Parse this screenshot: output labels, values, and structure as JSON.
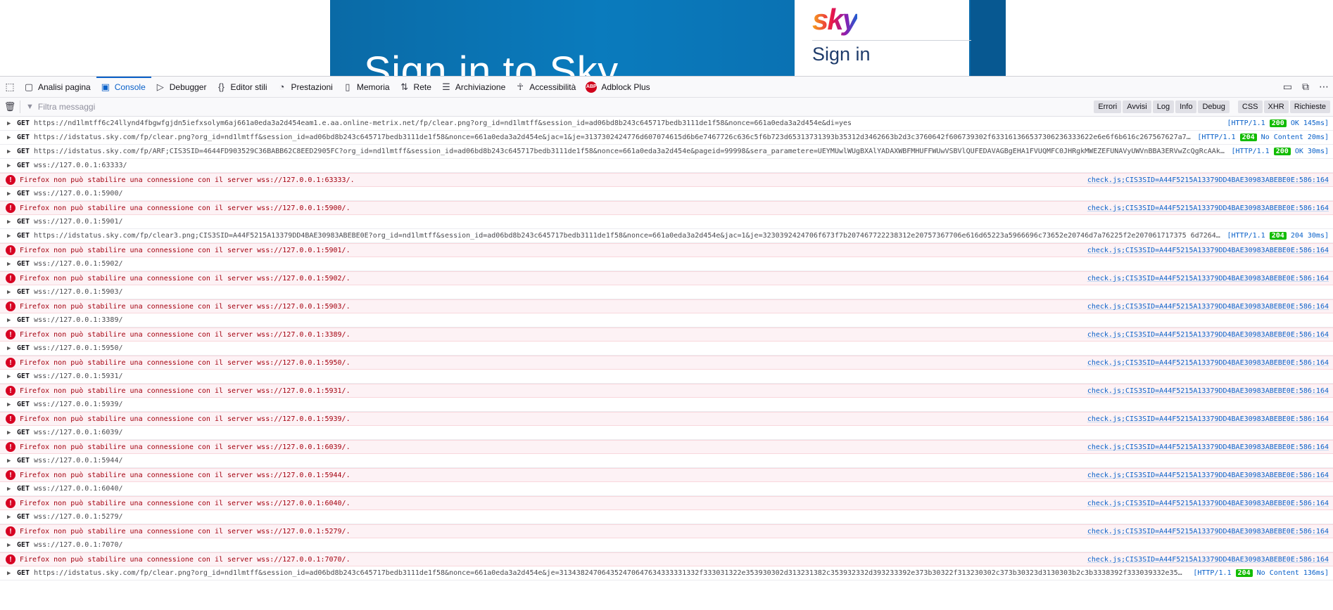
{
  "page": {
    "hero_title": "Sign in to Sky",
    "logo_text": "sky",
    "card_heading": "Sign in"
  },
  "toolbar": {
    "tabs": [
      {
        "label": "Analisi pagina",
        "icon": "inspector-icon"
      },
      {
        "label": "Console",
        "icon": "console-icon",
        "selected": true
      },
      {
        "label": "Debugger",
        "icon": "debugger-icon"
      },
      {
        "label": "Editor stili",
        "icon": "style-editor-icon"
      },
      {
        "label": "Prestazioni",
        "icon": "performance-icon"
      },
      {
        "label": "Memoria",
        "icon": "memory-icon"
      },
      {
        "label": "Rete",
        "icon": "network-icon"
      },
      {
        "label": "Archiviazione",
        "icon": "storage-icon"
      },
      {
        "label": "Accessibilità",
        "icon": "accessibility-icon"
      },
      {
        "label": "Adblock Plus",
        "icon": "adblock-icon"
      }
    ],
    "abp_badge": "ABP"
  },
  "filter": {
    "placeholder": "Filtra messaggi",
    "levels": [
      "Errori",
      "Avvisi",
      "Log",
      "Info",
      "Debug"
    ],
    "types": [
      "CSS",
      "XHR",
      "Richieste"
    ]
  },
  "colors": {
    "accent": "#0a61c9",
    "error_text": "#a4000f",
    "error_bg": "#fdf2f5",
    "status_ok": "#12bc00"
  },
  "messages": [
    {
      "kind": "net",
      "method": "GET",
      "url": "https://nd1lmtff6c24llynd4fbgwfgjdn5iefxsolym6aj661a0eda3a2d454eam1.e.aa.online-metrix.net/fp/clear.png?org_id=nd1lmtff&session_id=ad06bd8b243c645717bedb3111de1f58&nonce=661a0eda3a2d454e&di=yes",
      "proto": "[HTTP/1.1",
      "code": "200",
      "status_text": "OK 145ms]"
    },
    {
      "kind": "net",
      "method": "GET",
      "url": "https://idstatus.sky.com/fp/clear.png?org_id=nd1lmtff&session_id=ad06bd8b243c645717bedb3111de1f58&nonce=661a0eda3a2d454e&jac=1&je=3137302424776d607074615d6b6e7467726c636c5f6b723d65313731393b35312d3462663b2d3c3760642f606739302f633161366537306236333622e6e6f6b616c267567627a7…",
      "proto": "[HTTP/1.1",
      "code": "204",
      "status_text": "No Content 20ms]"
    },
    {
      "kind": "net",
      "method": "GET",
      "url": "https://idstatus.sky.com/fp/ARF;CIS3SID=4644FD903529C36BABB62C8EED2905FC?org_id=nd1lmtff&session_id=ad06bd8b243c645717bedb3111de1f58&nonce=661a0eda3a2d454e&pageid=99998&sera_parametere=UEYMUwlWUgBXAlYADAXWBFMHUFFWUwVSBVlQUFEDAVAGBgEHA1FVUQMFC0JHRgkMWEZEFUNAVyUWVnBBA3ERVwZcQgRcAAkE…",
      "proto": "[HTTP/1.1",
      "code": "200",
      "status_text": "OK 30ms]"
    },
    {
      "kind": "net",
      "method": "GET",
      "url": "wss://127.0.0.1:63333/"
    },
    {
      "kind": "err",
      "text": "Firefox non può stabilire una connessione con il server wss://127.0.0.1:63333/.",
      "source": "check.js;CIS3SID=A44F5215A13379DD4BAE30983ABEBE0E:586:164"
    },
    {
      "kind": "net",
      "method": "GET",
      "url": "wss://127.0.0.1:5900/"
    },
    {
      "kind": "err",
      "text": "Firefox non può stabilire una connessione con il server wss://127.0.0.1:5900/.",
      "source": "check.js;CIS3SID=A44F5215A13379DD4BAE30983ABEBE0E:586:164"
    },
    {
      "kind": "net",
      "method": "GET",
      "url": "wss://127.0.0.1:5901/"
    },
    {
      "kind": "net",
      "method": "GET",
      "url": "https://idstatus.sky.com/fp/clear3.png;CIS3SID=A44F5215A13379DD4BAE30983ABEBE0E?org_id=nd1lmtff&session_id=ad06bd8b243c645717bedb3111de1f58&nonce=661a0eda3a2d454e&jac=1&je=3230392424706f673f7b207467722238312e20757367706e616d65223a5966696c73652e20746d7a76225f2e207061717375 6d726420…",
      "proto": "[HTTP/1.1",
      "code": "204",
      "status_text": "204 30ms]"
    },
    {
      "kind": "err",
      "text": "Firefox non può stabilire una connessione con il server wss://127.0.0.1:5901/.",
      "source": "check.js;CIS3SID=A44F5215A13379DD4BAE30983ABEBE0E:586:164"
    },
    {
      "kind": "net",
      "method": "GET",
      "url": "wss://127.0.0.1:5902/"
    },
    {
      "kind": "err",
      "text": "Firefox non può stabilire una connessione con il server wss://127.0.0.1:5902/.",
      "source": "check.js;CIS3SID=A44F5215A13379DD4BAE30983ABEBE0E:586:164"
    },
    {
      "kind": "net",
      "method": "GET",
      "url": "wss://127.0.0.1:5903/"
    },
    {
      "kind": "err",
      "text": "Firefox non può stabilire una connessione con il server wss://127.0.0.1:5903/.",
      "source": "check.js;CIS3SID=A44F5215A13379DD4BAE30983ABEBE0E:586:164"
    },
    {
      "kind": "net",
      "method": "GET",
      "url": "wss://127.0.0.1:3389/"
    },
    {
      "kind": "err",
      "text": "Firefox non può stabilire una connessione con il server wss://127.0.0.1:3389/.",
      "source": "check.js;CIS3SID=A44F5215A13379DD4BAE30983ABEBE0E:586:164"
    },
    {
      "kind": "net",
      "method": "GET",
      "url": "wss://127.0.0.1:5950/"
    },
    {
      "kind": "err",
      "text": "Firefox non può stabilire una connessione con il server wss://127.0.0.1:5950/.",
      "source": "check.js;CIS3SID=A44F5215A13379DD4BAE30983ABEBE0E:586:164"
    },
    {
      "kind": "net",
      "method": "GET",
      "url": "wss://127.0.0.1:5931/"
    },
    {
      "kind": "err",
      "text": "Firefox non può stabilire una connessione con il server wss://127.0.0.1:5931/.",
      "source": "check.js;CIS3SID=A44F5215A13379DD4BAE30983ABEBE0E:586:164"
    },
    {
      "kind": "net",
      "method": "GET",
      "url": "wss://127.0.0.1:5939/"
    },
    {
      "kind": "err",
      "text": "Firefox non può stabilire una connessione con il server wss://127.0.0.1:5939/.",
      "source": "check.js;CIS3SID=A44F5215A13379DD4BAE30983ABEBE0E:586:164"
    },
    {
      "kind": "net",
      "method": "GET",
      "url": "wss://127.0.0.1:6039/"
    },
    {
      "kind": "err",
      "text": "Firefox non può stabilire una connessione con il server wss://127.0.0.1:6039/.",
      "source": "check.js;CIS3SID=A44F5215A13379DD4BAE30983ABEBE0E:586:164"
    },
    {
      "kind": "net",
      "method": "GET",
      "url": "wss://127.0.0.1:5944/"
    },
    {
      "kind": "err",
      "text": "Firefox non può stabilire una connessione con il server wss://127.0.0.1:5944/.",
      "source": "check.js;CIS3SID=A44F5215A13379DD4BAE30983ABEBE0E:586:164"
    },
    {
      "kind": "net",
      "method": "GET",
      "url": "wss://127.0.0.1:6040/"
    },
    {
      "kind": "err",
      "text": "Firefox non può stabilire una connessione con il server wss://127.0.0.1:6040/.",
      "source": "check.js;CIS3SID=A44F5215A13379DD4BAE30983ABEBE0E:586:164"
    },
    {
      "kind": "net",
      "method": "GET",
      "url": "wss://127.0.0.1:5279/"
    },
    {
      "kind": "err",
      "text": "Firefox non può stabilire una connessione con il server wss://127.0.0.1:5279/.",
      "source": "check.js;CIS3SID=A44F5215A13379DD4BAE30983ABEBE0E:586:164"
    },
    {
      "kind": "net",
      "method": "GET",
      "url": "wss://127.0.0.1:7070/"
    },
    {
      "kind": "err",
      "text": "Firefox non può stabilire una connessione con il server wss://127.0.0.1:7070/.",
      "source": "check.js;CIS3SID=A44F5215A13379DD4BAE30983ABEBE0E:586:164"
    },
    {
      "kind": "net",
      "method": "GET",
      "url": "https://idstatus.sky.com/fp/clear.png?org_id=nd1lmtff&session_id=ad06bd8b243c645717bedb3111de1f58&nonce=661a0eda3a2d454e&je=313438247064352470647634333331332f333031322e353930302d313231382c353932332d393233392e373b30322f313230302c373b30323d3130303b2c3b3338392f333039332e35…",
      "proto": "[HTTP/1.1",
      "code": "204",
      "status_text": "No Content 136ms]"
    }
  ]
}
